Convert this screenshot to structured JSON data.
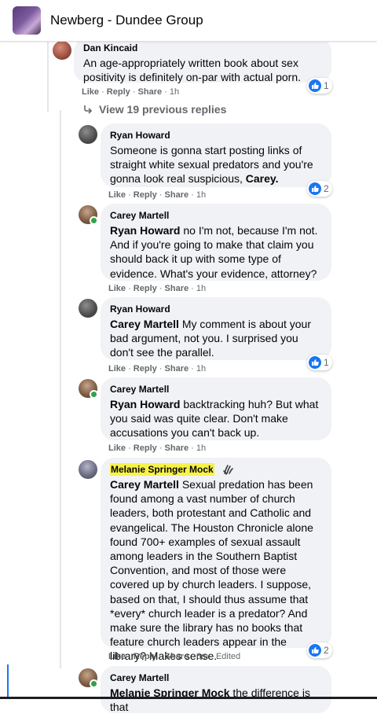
{
  "header": {
    "group_name": "Newberg - Dundee Group"
  },
  "view_previous_replies": "View 19 previous replies",
  "comments": [
    {
      "author": "Dan Kincaid",
      "text": "An age-appropriately written book about sex positivity is definitely on-par with actual porn.",
      "actions": {
        "like": "Like",
        "reply": "Reply",
        "share": "Share",
        "time": "1h"
      },
      "reactions": "1"
    },
    {
      "author": "Ryan Howard",
      "text_pre": "Someone is gonna start posting links of straight white sexual predators and you're gonna look real suspicious, ",
      "mention": "Carey.",
      "actions": {
        "like": "Like",
        "reply": "Reply",
        "share": "Share",
        "time": "1h"
      },
      "reactions": "2"
    },
    {
      "author": "Carey Martell",
      "mention": "Ryan Howard",
      "text": " no I'm not, because I'm not. And if you're going to make that claim you should back it up with some type of evidence. What's your evidence, attorney?",
      "actions": {
        "like": "Like",
        "reply": "Reply",
        "share": "Share",
        "time": "1h"
      }
    },
    {
      "author": "Ryan Howard",
      "mention": "Carey Martell",
      "text": " My comment is about your bad argument, not you. I surprised you don't see the parallel.",
      "actions": {
        "like": "Like",
        "reply": "Reply",
        "share": "Share",
        "time": "1h"
      },
      "reactions": "1"
    },
    {
      "author": "Carey Martell",
      "mention": "Ryan Howard",
      "text": " backtracking huh? But what you said was quite clear. Don't make accusations you can't back up.",
      "actions": {
        "like": "Like",
        "reply": "Reply",
        "share": "Share",
        "time": "1h"
      }
    },
    {
      "author": "Melanie Springer Mock",
      "mention": "Carey Martell",
      "text": " Sexual predation has been found among a vast number of church leaders, both protestant and Catholic and evangelical. The Houston Chronicle alone found 700+ examples of sexual assault among leaders in the Southern Baptist Convention, and most of those were covered up by church leaders. I suppose, based on that, I should thus assume that *every* church leader is a predator? And make sure the library has no books that feature church leaders appear in the library? Makes sense.",
      "actions": {
        "like": "Like",
        "reply": "Reply",
        "share": "Share",
        "time": "6m",
        "edited": "Edited"
      },
      "reactions": "2"
    },
    {
      "author": "Carey Martell",
      "mention": "Melanie Springer Mock",
      "text": " the difference is that"
    }
  ],
  "colors": {
    "accent": "#1877f2",
    "bubble": "#f0f2f5",
    "highlight": "#f7f24a",
    "meta": "#65676b",
    "online": "#31a24c"
  },
  "icons": [
    "like-icon",
    "reply-arrow-icon",
    "fan-badge-icon"
  ]
}
